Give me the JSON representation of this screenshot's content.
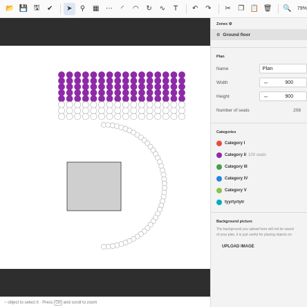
{
  "toolbar": {
    "buttons": [
      {
        "icon": "folder-open-icon"
      },
      {
        "icon": "save-icon"
      },
      {
        "icon": "export-icon"
      },
      {
        "icon": "check-circle-icon"
      },
      {
        "icon": "select-arrow-icon",
        "active": true
      },
      {
        "icon": "select-seats-icon"
      },
      {
        "icon": "seat-grid-icon"
      },
      {
        "icon": "seat-row-icon"
      },
      {
        "icon": "arc-tool-icon"
      },
      {
        "icon": "circle-arc-icon"
      },
      {
        "icon": "rotate-icon"
      },
      {
        "icon": "curve-icon"
      },
      {
        "icon": "text-tool-icon"
      },
      {
        "icon": "undo-icon"
      },
      {
        "icon": "redo-icon"
      },
      {
        "icon": "cut-icon"
      },
      {
        "icon": "copy-icon"
      },
      {
        "icon": "paste-icon"
      },
      {
        "icon": "delete-icon"
      },
      {
        "icon": "zoom-icon"
      }
    ],
    "zoom": "79%"
  },
  "zones": {
    "title": "Zones",
    "items": [
      {
        "label": "Ground floor"
      }
    ]
  },
  "plan": {
    "title": "Plan",
    "name_label": "Name",
    "name_value": "Plan",
    "width_label": "Width",
    "width_value": "900",
    "height_label": "Height",
    "height_value": "900",
    "seats_label": "Number of seats",
    "seats_value": "208"
  },
  "categories": {
    "title": "Categories",
    "items": [
      {
        "label": "Category I",
        "color": "#e84b3c",
        "seats": ""
      },
      {
        "label": "Category II",
        "color": "#8e2aa8",
        "seats": "100 seats"
      },
      {
        "label": "Category III",
        "color": "#43a047",
        "seats": ""
      },
      {
        "label": "Category IV",
        "color": "#1e88e5",
        "seats": ""
      },
      {
        "label": "Category V",
        "color": "#8bc34a",
        "seats": ""
      },
      {
        "label": "tyyrtyrtytr",
        "color": "#00acc1",
        "seats": ""
      }
    ]
  },
  "background": {
    "title": "Background picture",
    "line1": "The background you upload here will not be saved",
    "line2": "of your plan, it is just useful for placing objects on",
    "upload_label": "UPLOAD IMAGE"
  },
  "status": {
    "prefix": "~ object to select it · Press",
    "key": "Ctrl",
    "suffix": "and scroll to zoom"
  },
  "seating": {
    "grid_rows": 8,
    "grid_cols": 16,
    "purple_rows": 5,
    "arc_seats": 44,
    "purple_color": "#8e2aa8"
  }
}
